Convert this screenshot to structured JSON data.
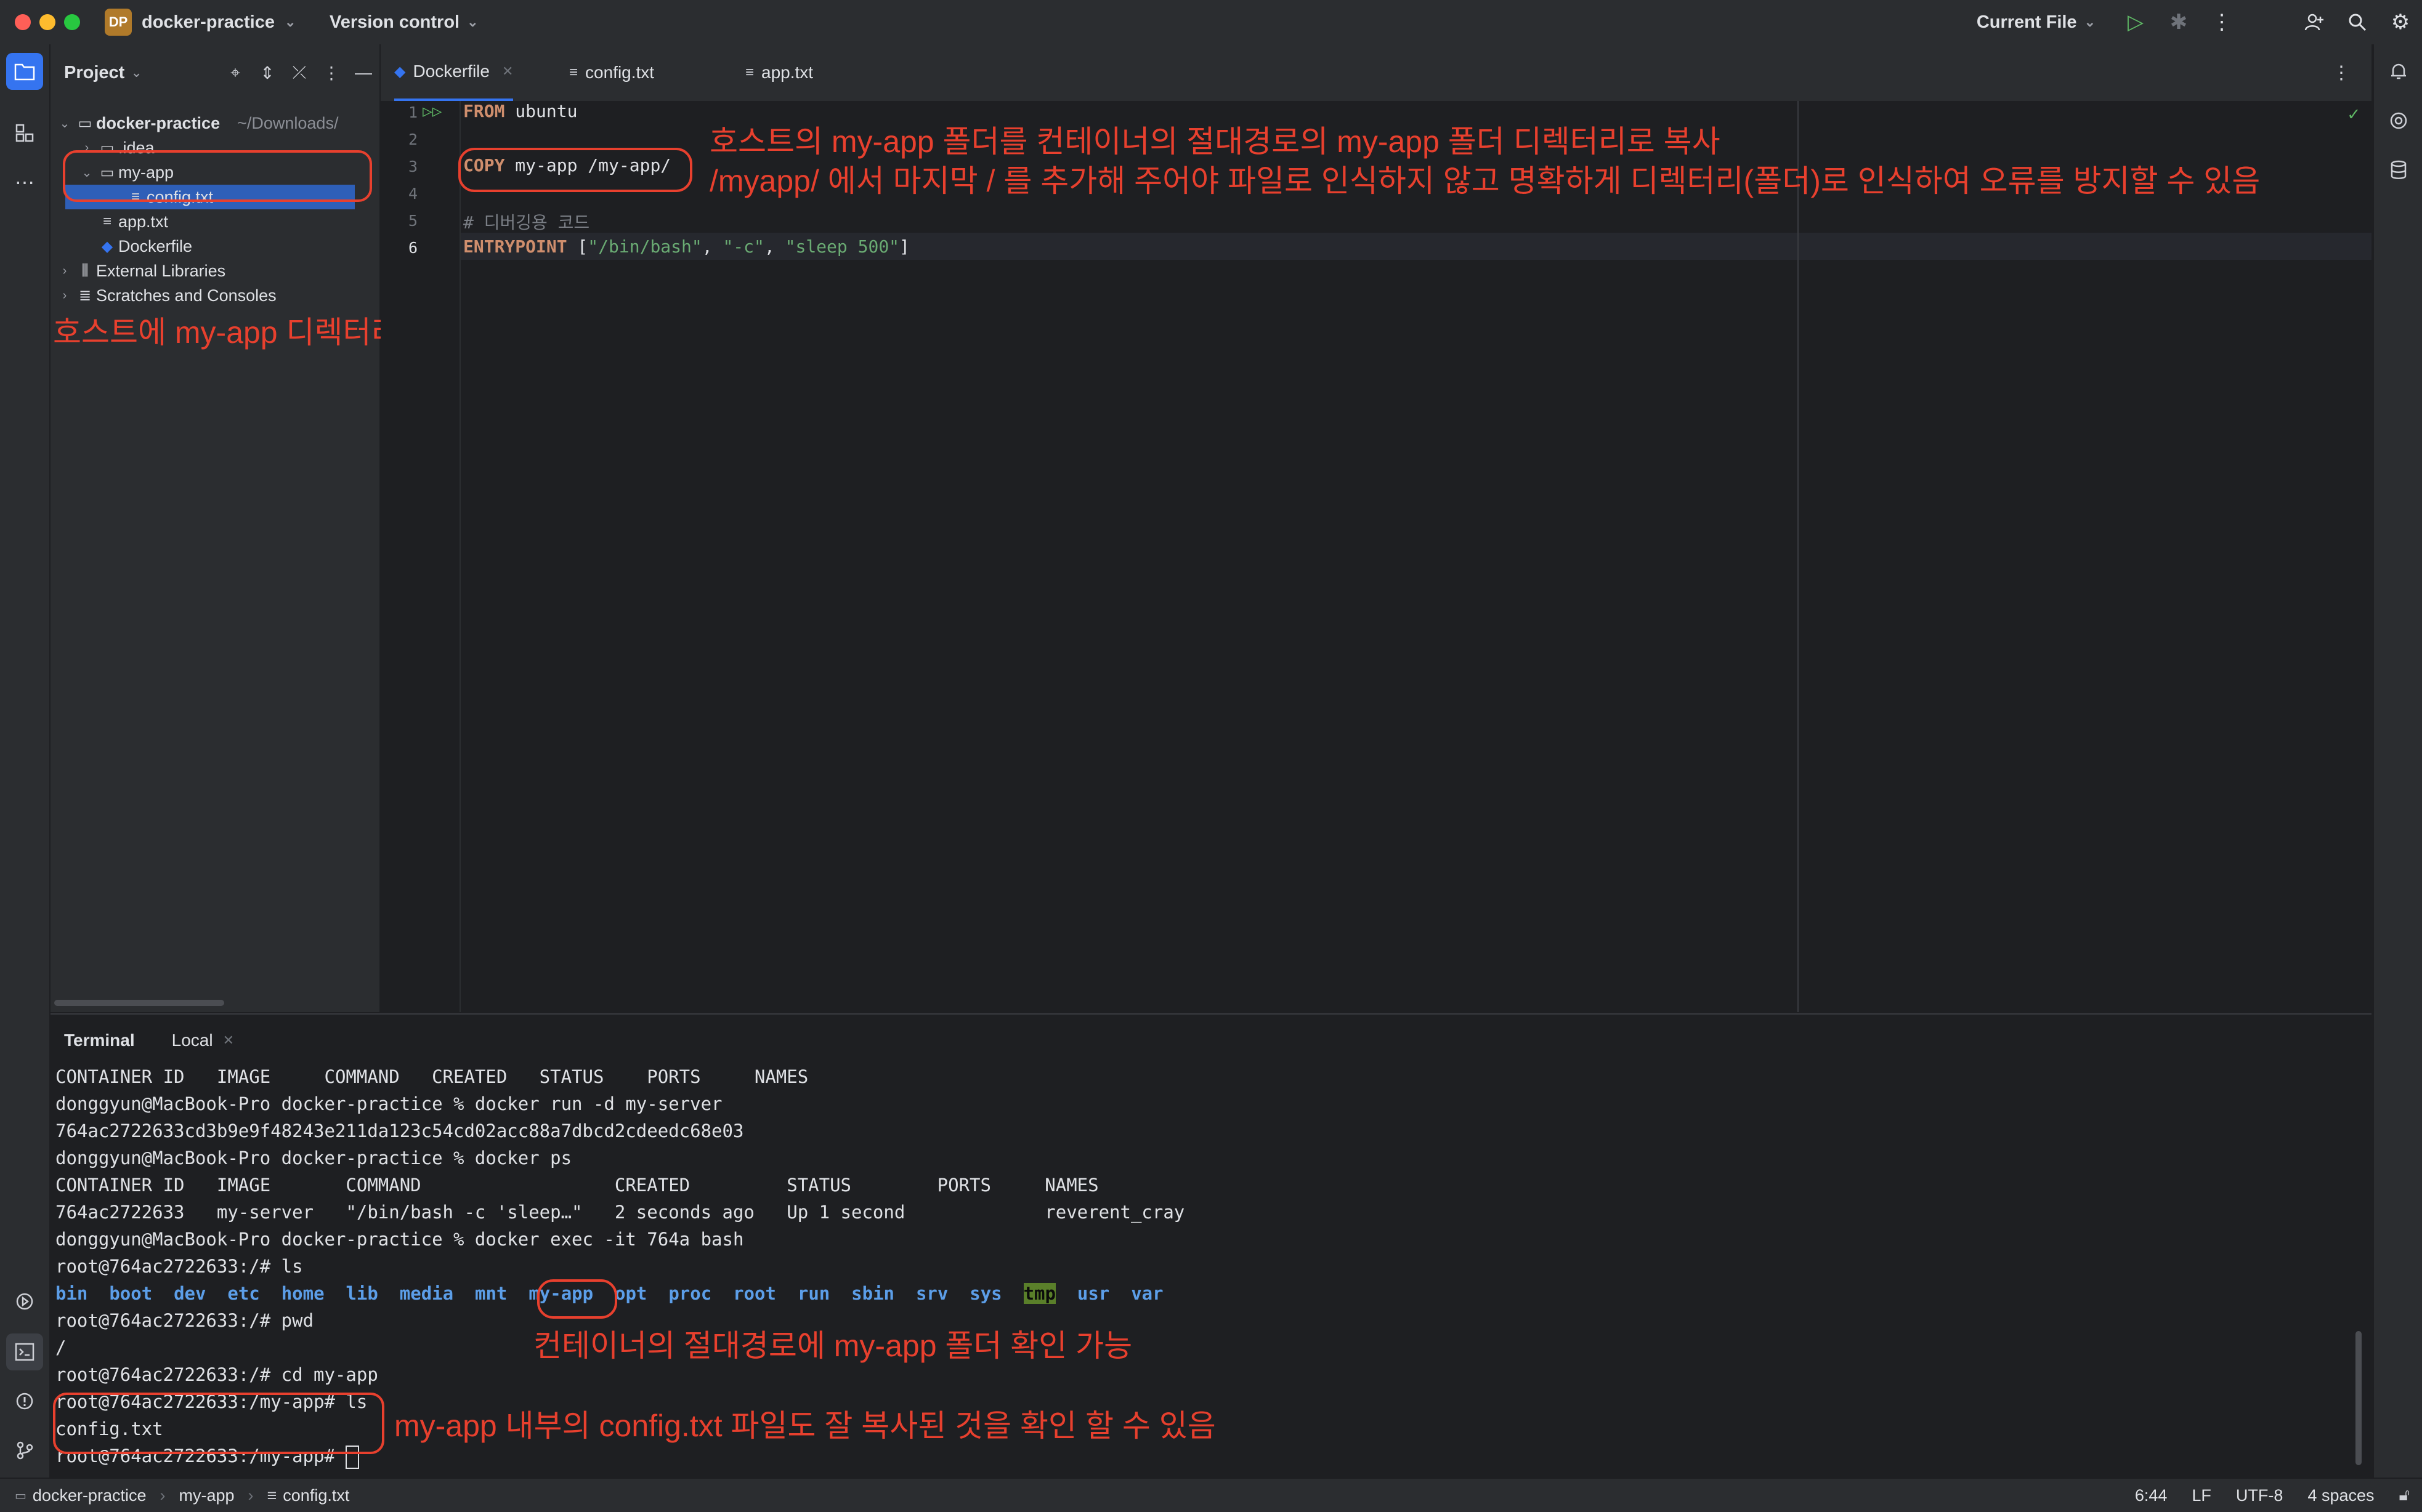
{
  "titlebar": {
    "project_badge": "DP",
    "project_name": "docker-practice",
    "version_control": "Version control",
    "run_config": "Current File"
  },
  "project_panel": {
    "title": "Project",
    "root_name": "docker-practice",
    "root_path": "~/Downloads/",
    "items": [
      {
        "label": ".idea"
      },
      {
        "label": "my-app"
      },
      {
        "label": "config.txt"
      },
      {
        "label": "app.txt"
      },
      {
        "label": "Dockerfile"
      },
      {
        "label": "External Libraries"
      },
      {
        "label": "Scratches and Consoles"
      }
    ]
  },
  "editor": {
    "tabs": [
      {
        "label": "Dockerfile"
      },
      {
        "label": "config.txt"
      },
      {
        "label": "app.txt"
      }
    ],
    "line_numbers": [
      "1",
      "2",
      "3",
      "4",
      "5",
      "6"
    ],
    "code": {
      "l1_kw": "FROM",
      "l1_rest": " ubuntu",
      "l3_kw": "COPY",
      "l3_rest": " my-app /my-app/",
      "l5_comment": "# 디버깅용 코드",
      "l6_kw": "ENTRYPOINT",
      "l6_open": " [",
      "l6_s1": "\"/bin/bash\"",
      "l6_c1": ", ",
      "l6_s2": "\"-c\"",
      "l6_c2": ", ",
      "l6_s3": "\"sleep 500\"",
      "l6_close": "]"
    }
  },
  "annotations": {
    "editor_line1": "호스트의 my-app 폴더를 컨테이너의 절대경로의 my-app 폴더 디렉터리로 복사",
    "editor_line2": "/myapp/ 에서 마지막 / 를 추가해 주어야 파일로 인식하지 않고 명확하게 디렉터리(폴더)로 인식하여 오류를 방지할 수 있음",
    "project": "호스트에 my-app 디렉터리를 생성하고, config.txt 파일을 하나 생성",
    "term_ls": "컨테이너의 절대경로에 my-app 폴더 확인 가능",
    "term_config": "my-app 내부의 config.txt 파일도 잘 복사된 것을 확인 할 수 있음"
  },
  "terminal": {
    "title": "Terminal",
    "tab": "Local",
    "lines": [
      "CONTAINER ID   IMAGE     COMMAND   CREATED   STATUS    PORTS     NAMES",
      "donggyun@MacBook-Pro docker-practice % docker run -d my-server",
      "764ac2722633cd3b9e9f48243e211da123c54cd02acc88a7dbcd2cdeedc68e03",
      "donggyun@MacBook-Pro docker-practice % docker ps",
      "CONTAINER ID   IMAGE       COMMAND                  CREATED         STATUS        PORTS     NAMES",
      "764ac2722633   my-server   \"/bin/bash -c 'sleep…\"   2 seconds ago   Up 1 second             reverent_cray",
      "donggyun@MacBook-Pro docker-practice % docker exec -it 764a bash",
      "root@764ac2722633:/# ls",
      "root@764ac2722633:/# pwd",
      "/",
      "root@764ac2722633:/# cd my-app",
      "root@764ac2722633:/my-app# ls",
      "config.txt",
      "root@764ac2722633:/my-app# "
    ],
    "ls_entries": [
      "bin",
      "boot",
      "dev",
      "etc",
      "home",
      "lib",
      "media",
      "mnt",
      "my-app",
      "opt",
      "proc",
      "root",
      "run",
      "sbin",
      "srv",
      "sys",
      "tmp",
      "usr",
      "var"
    ]
  },
  "statusbar": {
    "crumbs": [
      "docker-practice",
      "my-app",
      "config.txt"
    ],
    "position": "6:44",
    "line_sep": "LF",
    "encoding": "UTF-8",
    "indent": "4 spaces"
  },
  "colors": {
    "annotation": "#e8402e",
    "selection": "#2e5fb8",
    "keyword": "#cf8e6d",
    "string": "#6aab73",
    "directory": "#5c9ee8"
  }
}
